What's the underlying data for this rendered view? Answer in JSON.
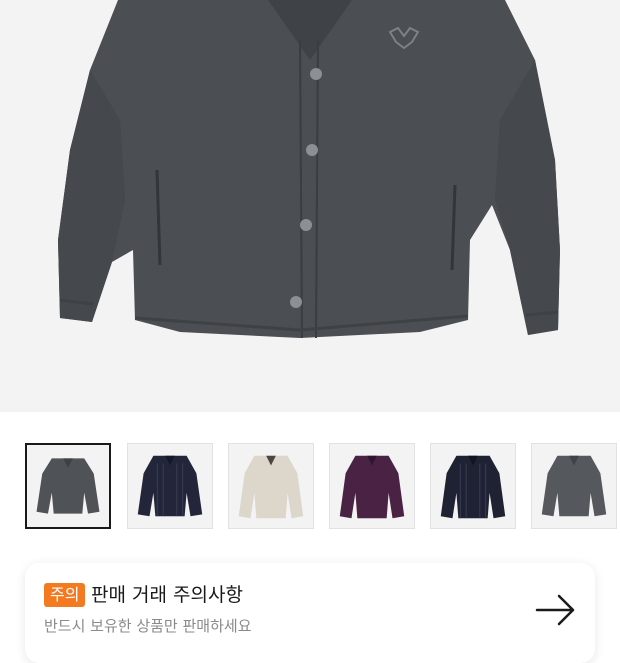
{
  "product": {
    "image_alt": "charcoal fleece cardigan",
    "colors": {
      "background": "#f3f3f3",
      "main_garment": "#4b4e52"
    }
  },
  "thumbnails": [
    {
      "color": "#4f5256",
      "name": "charcoal",
      "selected": true
    },
    {
      "color": "#23253a",
      "name": "navy-stripe",
      "selected": false
    },
    {
      "color": "#ddd6cb",
      "name": "ivory",
      "selected": false
    },
    {
      "color": "#4a2344",
      "name": "purple",
      "selected": false
    },
    {
      "color": "#1f2233",
      "name": "navy-stripe-2",
      "selected": false
    },
    {
      "color": "#55595d",
      "name": "charcoal-2",
      "selected": false
    }
  ],
  "notice": {
    "badge": "주의",
    "title": "판매 거래 주의사항",
    "description": "반드시 보유한 상품만 판매하세요",
    "badge_color": "#f47a22",
    "arrow_icon": "arrow-right-icon"
  }
}
